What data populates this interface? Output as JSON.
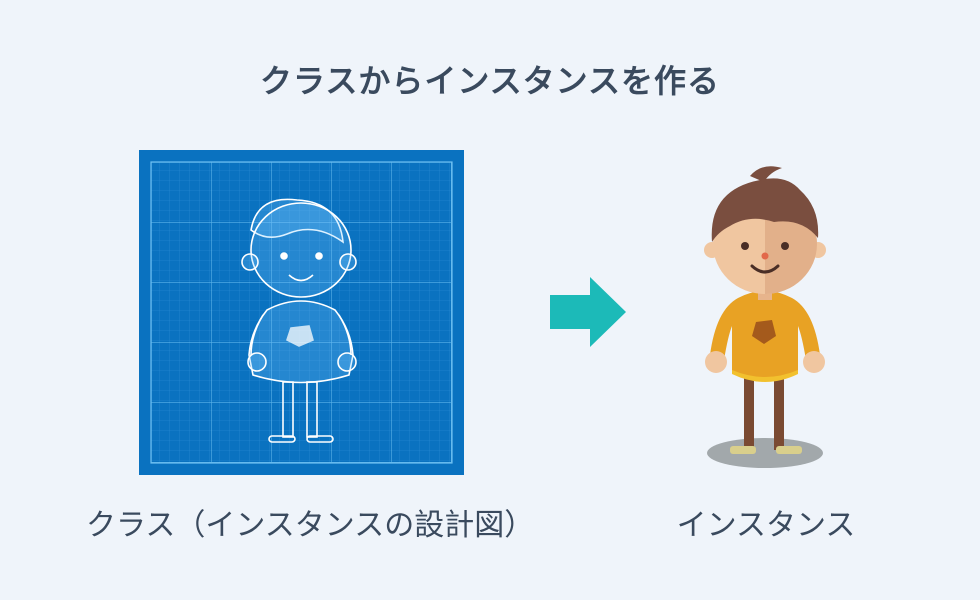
{
  "title": "クラスからインスタンスを作る",
  "class_caption": "クラス（インスタンスの設計図）",
  "instance_caption": "インスタンス",
  "colors": {
    "background": "#eff4fa",
    "blueprint": "#0a72c0",
    "arrow": "#1cbab8",
    "sweater": "#e8a224",
    "hair": "#7a4e3f",
    "skin": "#f0c6a0",
    "text": "#3a4a5e"
  }
}
